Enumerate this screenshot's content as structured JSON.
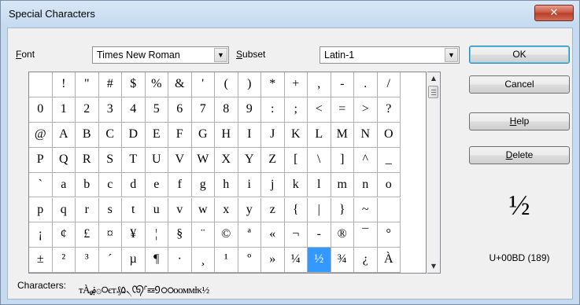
{
  "window": {
    "title": "Special Characters",
    "close_glyph": "✕"
  },
  "controls": {
    "font_label": "Font",
    "font_value": "Times New Roman",
    "subset_label": "Subset",
    "subset_value": "Latin-1",
    "dropdown_glyph": "▼"
  },
  "buttons": {
    "ok": "OK",
    "cancel": "Cancel",
    "help": "Help",
    "delete": "Delete"
  },
  "grid": {
    "columns": 17,
    "selected": "½",
    "rows": [
      [
        " ",
        "!",
        "\"",
        "#",
        "$",
        "%",
        "&",
        "'",
        "(",
        ")",
        "*",
        "+",
        ",",
        "-",
        ".",
        "/"
      ],
      [
        "0",
        "1",
        "2",
        "3",
        "4",
        "5",
        "6",
        "7",
        "8",
        "9",
        ":",
        ";",
        "<",
        "=",
        ">",
        "?"
      ],
      [
        "@",
        "A",
        "B",
        "C",
        "D",
        "E",
        "F",
        "G",
        "H",
        "I",
        "J",
        "K",
        "L",
        "M",
        "N",
        "O"
      ],
      [
        "P",
        "Q",
        "R",
        "S",
        "T",
        "U",
        "V",
        "W",
        "X",
        "Y",
        "Z",
        "[",
        "\\",
        "]",
        "^",
        "_"
      ],
      [
        "`",
        "a",
        "b",
        "c",
        "d",
        "e",
        "f",
        "g",
        "h",
        "i",
        "j",
        "k",
        "l",
        "m",
        "n",
        "o"
      ],
      [
        "p",
        "q",
        "r",
        "s",
        "t",
        "u",
        "v",
        "w",
        "x",
        "y",
        "z",
        "{",
        "|",
        "}",
        "~",
        " "
      ],
      [
        "¡",
        "¢",
        "£",
        "¤",
        "¥",
        "¦",
        "§",
        "¨",
        "©",
        "ª",
        "«",
        "¬",
        "-",
        "®",
        "¯",
        "°"
      ],
      [
        "±",
        "²",
        "³",
        "´",
        "µ",
        "¶",
        "·",
        "¸",
        "¹",
        "º",
        "»",
        "¼",
        "½",
        "¾",
        "¿",
        "À"
      ]
    ]
  },
  "scroll": {
    "up_glyph": "▲",
    "down_glyph": "▼"
  },
  "preview": {
    "char": "½",
    "code": "U+00BD (189)"
  },
  "characters": {
    "label": "Characters:",
    "value": "ᴛÀۻ۞◯єт₰۵৲ᢗᢒᣗ☲᠑ഠഠoомᴍɫκ½"
  }
}
